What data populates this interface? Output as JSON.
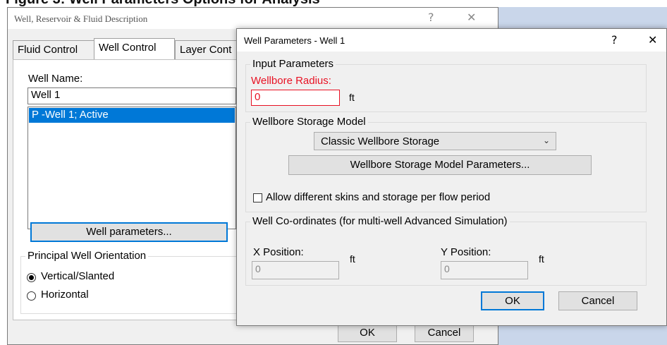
{
  "figure_caption": "Figure 3: Well Parameters Options for Analysis",
  "outer_dialog": {
    "title": "Well, Reservoir & Fluid Description",
    "help": "?",
    "close": "✕",
    "tabs": [
      "Fluid Control",
      "Well Control",
      "Layer Cont"
    ],
    "well_name_label": "Well Name:",
    "well_name_value": "Well 1",
    "well_list_items": [
      "P -Well 1; Active"
    ],
    "well_parameters_button": "Well parameters...",
    "orientation_group": "Principal Well Orientation",
    "orientation_options": [
      "Vertical/Slanted",
      "Horizontal"
    ],
    "orientation_selected": "Vertical/Slanted",
    "ok_button": "OK",
    "cancel_button": "Cancel"
  },
  "inner_dialog": {
    "title": "Well Parameters - Well 1",
    "help": "?",
    "close": "✕",
    "input_group": "Input Parameters",
    "wellbore_radius_label": "Wellbore Radius:",
    "wellbore_radius_value": "0",
    "wellbore_radius_unit": "ft",
    "storage_group": "Wellbore Storage Model",
    "storage_model_selected": "Classic Wellbore Storage",
    "storage_params_button": "Wellbore Storage Model Parameters...",
    "allow_diff_label": "Allow different skins and storage per flow period",
    "allow_diff_checked": false,
    "coords_group": "Well Co-ordinates (for multi-well Advanced Simulation)",
    "x_label": "X Position:",
    "x_unit": "ft",
    "x_value": "0",
    "y_label": "Y Position:",
    "y_unit": "ft",
    "y_value": "0",
    "ok_button": "OK",
    "cancel_button": "Cancel"
  },
  "colors": {
    "selection": "#0078d7",
    "error_label": "#e81123",
    "desktop_blue": "#c9d6ea"
  }
}
